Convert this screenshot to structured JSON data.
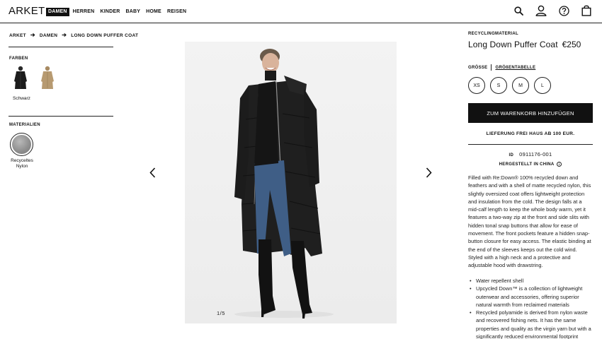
{
  "header": {
    "logo": "ARKET",
    "nav": [
      {
        "label": "DAMEN",
        "active": true
      },
      {
        "label": "HERREN",
        "active": false
      },
      {
        "label": "KINDER",
        "active": false
      },
      {
        "label": "BABY",
        "active": false
      },
      {
        "label": "HOME",
        "active": false
      },
      {
        "label": "REISEN",
        "active": false
      }
    ],
    "icons": [
      "search-icon",
      "account-icon",
      "help-icon",
      "bag-icon"
    ]
  },
  "breadcrumb": [
    "ARKET",
    "DAMEN",
    "LONG DOWN PUFFER COAT"
  ],
  "colors": {
    "label": "FARBEN",
    "options": [
      {
        "name": "Schwarz",
        "hex": "#1c1c1c",
        "selected": true
      },
      {
        "name": "Beige",
        "hex": "#b79a71",
        "selected": false
      }
    ],
    "selected_name": "Schwarz"
  },
  "materials": {
    "label": "MATERIALIEN",
    "selected_name": "Recyceltes Nylon"
  },
  "gallery": {
    "counter": "1/5"
  },
  "product": {
    "eyebrow": "RECYCLINGMATERIAL",
    "title": "Long Down Puffer Coat",
    "price": "€250",
    "size_label": "GRÖSSE",
    "size_guide": "GRÖßENTABELLE",
    "sizes": [
      "XS",
      "S",
      "M",
      "L"
    ],
    "cart_button": "ZUM WARENKORB HINZUFÜGEN",
    "shipping": "LIEFERUNG FREI HAUS AB 100 EUR.",
    "id_label": "ID",
    "id_value": "0911176-001",
    "made_in": "HERGESTELLT IN CHINA",
    "description": "Filled with Re:Down® 100% recycled down and feathers and with a shell of matte recycled nylon, this slightly oversized coat offers lightweight protection and insulation from the cold. The design falls at a mid-calf length to keep the whole body warm, yet it features a two-way zip at the front and side slits with hidden tonal snap buttons that allow for ease of movement. The front pockets feature a hidden snap-button closure for easy access. The elastic binding at the end of the sleeves keeps out the cold wind. Styled with a high neck and a protective and adjustable hood with drawstring.",
    "bullets": [
      "Water repellent shell",
      "Upcycled Down™ is a collection of lightweight outerwear and accessories, offering superior natural warmth from reclaimed materials",
      "Recycled polyamide is derived from nylon waste and recovered fishing nets. It has the same properties and quality as the virgin yarn but with a significantly reduced environmental footprint"
    ]
  }
}
